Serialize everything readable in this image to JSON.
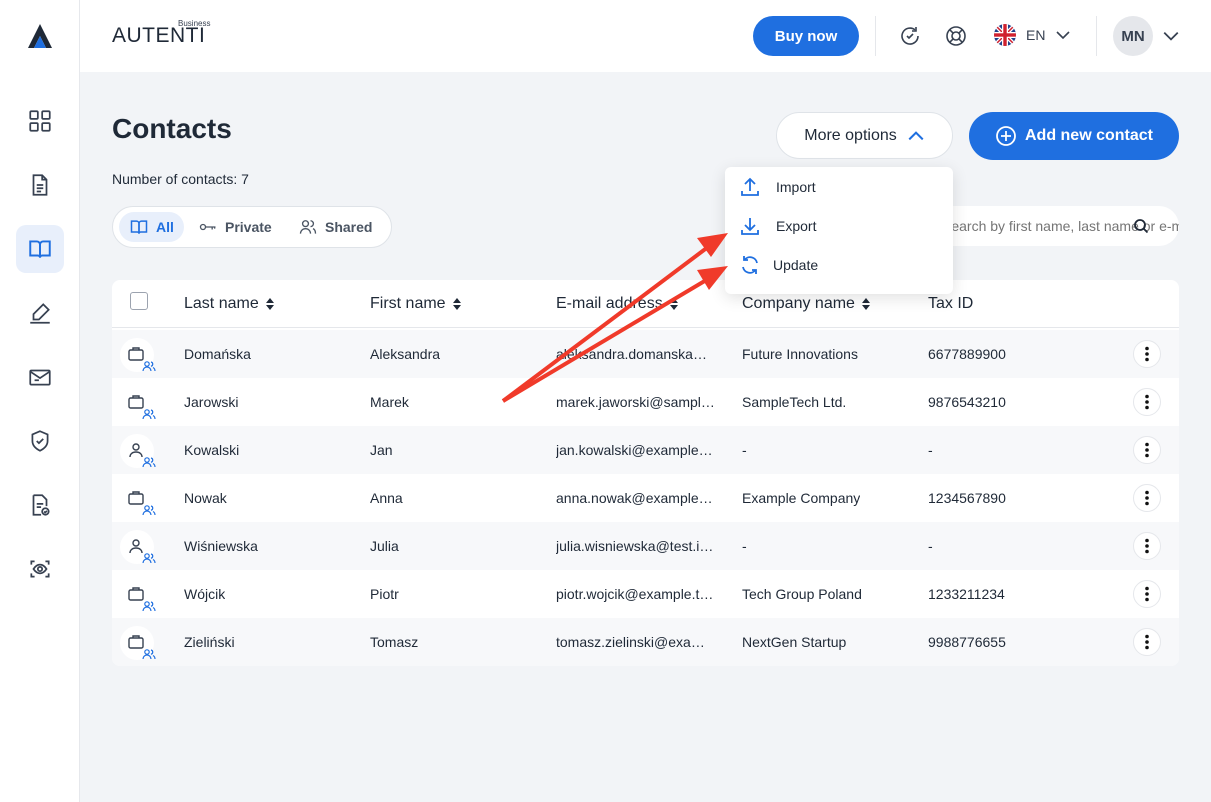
{
  "app": {
    "brand_name": "AUTENTI",
    "brand_tag": "Business"
  },
  "header": {
    "buy_label": "Buy now",
    "lang_code": "EN",
    "user_initials": "MN"
  },
  "page": {
    "title": "Contacts",
    "count_text": "Number of contacts: 7",
    "more_options_label": "More options",
    "add_contact_label": "Add new contact"
  },
  "filters": {
    "all": "All",
    "private": "Private",
    "shared": "Shared"
  },
  "search": {
    "placeholder": "Search by first name, last name or e-mail"
  },
  "dropdown": {
    "import": "Import",
    "export": "Export",
    "update": "Update"
  },
  "table": {
    "columns": [
      "Last name",
      "First name",
      "E-mail address",
      "Company name",
      "Tax ID"
    ],
    "rows": [
      {
        "type": "company",
        "last": "Domańska",
        "first": "Aleksandra",
        "email": "aleksandra.domanska@…",
        "company": "Future Innovations",
        "tax": "6677889900"
      },
      {
        "type": "company",
        "last": "Jarowski",
        "first": "Marek",
        "email": "marek.jaworski@sampl…",
        "company": "SampleTech Ltd.",
        "tax": "9876543210"
      },
      {
        "type": "person",
        "last": "Kowalski",
        "first": "Jan",
        "email": "jan.kowalski@example.…",
        "company": "-",
        "tax": "-"
      },
      {
        "type": "company",
        "last": "Nowak",
        "first": "Anna",
        "email": "anna.nowak@example.…",
        "company": "Example Company",
        "tax": "1234567890"
      },
      {
        "type": "person",
        "last": "Wiśniewska",
        "first": "Julia",
        "email": "julia.wisniewska@test.in…",
        "company": "-",
        "tax": "-"
      },
      {
        "type": "company",
        "last": "Wójcik",
        "first": "Piotr",
        "email": "piotr.wojcik@example.t…",
        "company": "Tech Group Poland",
        "tax": "1233211234"
      },
      {
        "type": "company",
        "last": "Zieliński",
        "first": "Tomasz",
        "email": "tomasz.zielinski@exam…",
        "company": "NextGen Startup",
        "tax": "9988776655"
      }
    ]
  },
  "colors": {
    "accent": "#1f6fe0",
    "annotation_arrow": "#f03a2a"
  }
}
